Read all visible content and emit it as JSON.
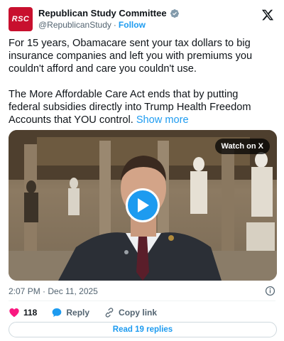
{
  "account": {
    "avatar_text": "RSC",
    "name": "Republican Study Committee",
    "handle": "@RepublicanStudy",
    "separator": "·",
    "follow_label": "Follow"
  },
  "tweet": {
    "paragraph1": "For 15 years, Obamacare sent your tax dollars to big insurance companies and left you with premiums you couldn't afford and care you couldn't use.",
    "paragraph2": "The More Affordable Care Act ends that by putting federal subsidies directly into Trump Health Freedom Accounts that YOU control.",
    "show_more": "Show more"
  },
  "video": {
    "watch_label": "Watch on X"
  },
  "meta": {
    "timestamp": "2:07 PM · Dec 11, 2025"
  },
  "actions": {
    "like_count": "118",
    "reply_label": "Reply",
    "copy_link_label": "Copy link"
  },
  "read_replies_label": "Read 19 replies",
  "colors": {
    "accent": "#1d9bf0",
    "like": "#f91880",
    "avatar_bg": "#c8102e"
  }
}
